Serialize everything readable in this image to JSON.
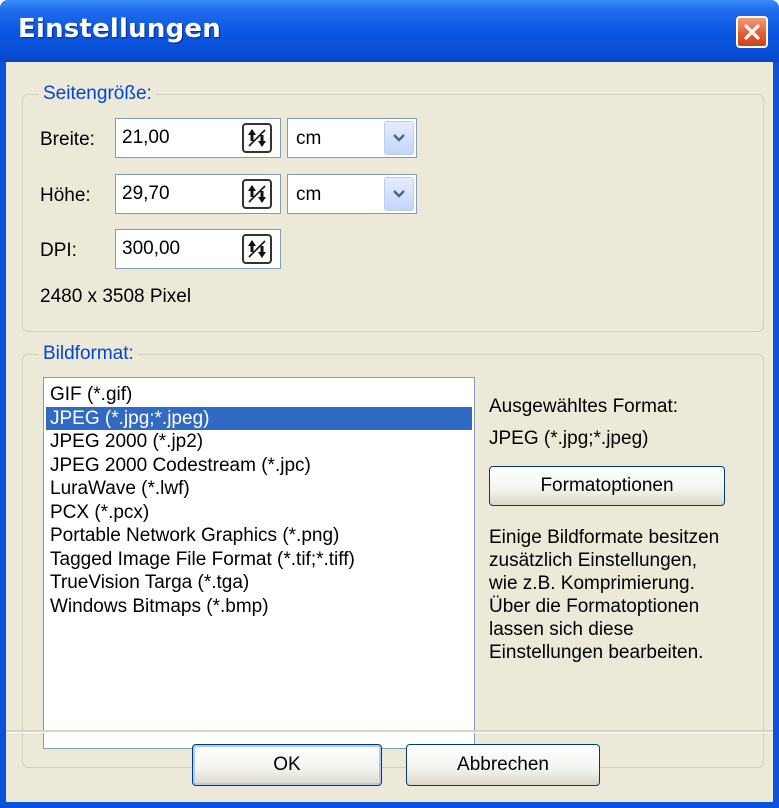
{
  "window": {
    "title": "Einstellungen"
  },
  "icons": {
    "close": "close-icon",
    "spin": "spin-updown-icon",
    "dropdown": "chevron-down-icon"
  },
  "colors": {
    "titlebar": "#0a55e0",
    "legend": "#0046d5",
    "selection": "#316ac5",
    "close_button": "#e25a2f"
  },
  "page_size": {
    "legend": "Seitengröße:",
    "width": {
      "label": "Breite:",
      "value": "21,00",
      "unit": "cm"
    },
    "height": {
      "label": "Höhe:",
      "value": "29,70",
      "unit": "cm"
    },
    "dpi": {
      "label": "DPI:",
      "value": "300,00"
    },
    "pixels": "2480 x 3508 Pixel"
  },
  "image_format": {
    "legend": "Bildformat:",
    "formats": [
      "GIF (*.gif)",
      "JPEG (*.jpg;*.jpeg)",
      "JPEG 2000 (*.jp2)",
      "JPEG 2000 Codestream (*.jpc)",
      "LuraWave (*.lwf)",
      "PCX (*.pcx)",
      "Portable Network Graphics (*.png)",
      "Tagged Image File Format (*.tif;*.tiff)",
      "TrueVision Targa (*.tga)",
      "Windows Bitmaps (*.bmp)"
    ],
    "selected_index": 1,
    "selected_label": "Ausgewähltes Format:",
    "selected_value": "JPEG (*.jpg;*.jpeg)",
    "options_button": "Formatoptionen",
    "description": [
      "Einige Bildformate besitzen",
      "zusätzlich Einstellungen,",
      "wie z.B. Komprimierung.",
      "Über die Formatoptionen",
      "lassen sich diese",
      "Einstellungen bearbeiten."
    ]
  },
  "buttons": {
    "ok": "OK",
    "cancel": "Abbrechen"
  }
}
